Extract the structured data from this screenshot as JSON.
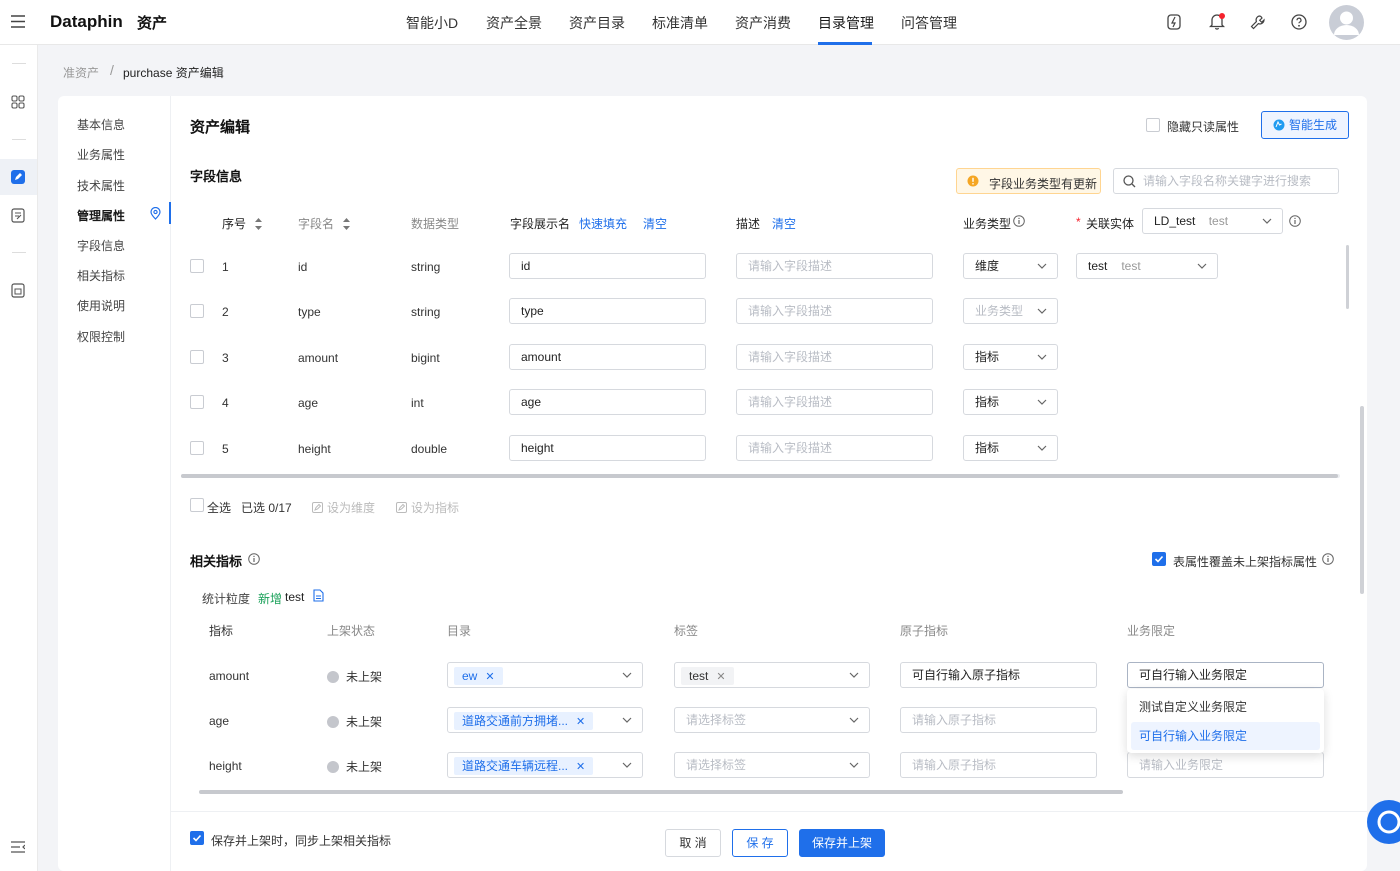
{
  "header": {
    "logo": "Dataphin",
    "product": "资产",
    "nav": [
      "智能小D",
      "资产全景",
      "资产目录",
      "标准清单",
      "资产消费",
      "目录管理",
      "问答管理"
    ],
    "active_nav": "目录管理"
  },
  "breadcrumb": {
    "parent": "准资产",
    "separator": "/",
    "current": "purchase 资产编辑"
  },
  "sidebar": {
    "items": [
      "基本信息",
      "业务属性",
      "技术属性",
      "管理属性",
      "字段信息",
      "相关指标",
      "使用说明",
      "权限控制"
    ],
    "active": "管理属性"
  },
  "page": {
    "title": "资产编辑",
    "hide_readonly_label": "隐藏只读属性",
    "smart_generate_label": "智能生成"
  },
  "fields": {
    "section_title": "字段信息",
    "update_notice": "字段业务类型有更新",
    "search_placeholder": "请输入字段名称关键字进行搜索",
    "headers": {
      "index": "序号",
      "name": "字段名",
      "type": "数据类型",
      "display": "字段展示名",
      "quick_fill": "快速填充",
      "clear1": "清空",
      "desc": "描述",
      "clear2": "清空",
      "biz_type": "业务类型",
      "required_mark": "*",
      "entity": "关联实体",
      "entity_value": "LD_test",
      "entity_sub": "test"
    },
    "rows": [
      {
        "index": "1",
        "name": "id",
        "type": "string",
        "display": "id",
        "desc_ph": "请输入字段描述",
        "biz": "维度",
        "biz_ph": false,
        "entity": "test",
        "entity_sub": "test"
      },
      {
        "index": "2",
        "name": "type",
        "type": "string",
        "display": "type",
        "desc_ph": "请输入字段描述",
        "biz": "业务类型",
        "biz_ph": true
      },
      {
        "index": "3",
        "name": "amount",
        "type": "bigint",
        "display": "amount",
        "desc_ph": "请输入字段描述",
        "biz": "指标",
        "biz_ph": false
      },
      {
        "index": "4",
        "name": "age",
        "type": "int",
        "display": "age",
        "desc_ph": "请输入字段描述",
        "biz": "指标",
        "biz_ph": false
      },
      {
        "index": "5",
        "name": "height",
        "type": "double",
        "display": "height",
        "desc_ph": "请输入字段描述",
        "biz": "指标",
        "biz_ph": false
      }
    ],
    "footer": {
      "select_all": "全选",
      "selected": "已选 0/17",
      "set_dim": "设为维度",
      "set_metric": "设为指标"
    }
  },
  "metrics": {
    "section_title": "相关指标",
    "override_label": "表属性覆盖未上架指标属性",
    "granularity_label": "统计粒度",
    "granularity_new": "新增",
    "granularity_value": "test",
    "headers": [
      "指标",
      "上架状态",
      "目录",
      "标签",
      "原子指标",
      "业务限定"
    ],
    "rows": [
      {
        "name": "amount",
        "status": "未上架",
        "catalog": "ew",
        "tag": "test",
        "tag_ph": false,
        "atomic": "可自行输入原子指标",
        "atomic_ph": false,
        "limit": "可自行输入业务限定",
        "limit_ph": false
      },
      {
        "name": "age",
        "status": "未上架",
        "catalog": "道路交通前方拥堵...",
        "tag": "请选择标签",
        "tag_ph": true,
        "atomic": "请输入原子指标",
        "atomic_ph": true,
        "limit": "",
        "limit_ph": true
      },
      {
        "name": "height",
        "status": "未上架",
        "catalog": "道路交通车辆远程...",
        "tag": "请选择标签",
        "tag_ph": true,
        "atomic": "请输入原子指标",
        "atomic_ph": true,
        "limit": "请输入业务限定",
        "limit_ph": true
      }
    ],
    "dropdown_options": [
      "测试自定义业务限定",
      "可自行输入业务限定"
    ]
  },
  "footer_bar": {
    "sync_label": "保存并上架时，同步上架相关指标",
    "cancel": "取 消",
    "save": "保 存",
    "save_publish": "保存并上架"
  },
  "colors": {
    "primary": "#1f6fea",
    "new_green": "#18a058",
    "warn": "#f5a623"
  }
}
